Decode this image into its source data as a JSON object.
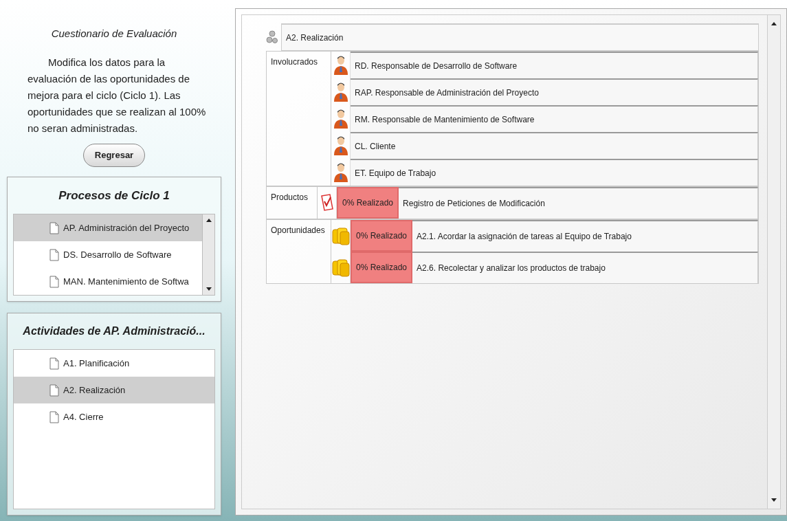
{
  "sidebar": {
    "title": "Cuestionario de Evaluación",
    "description": "Modifica los datos para la evaluación de las oportunidades de mejora para el ciclo (Ciclo 1). Las oportunidades que se realizan al 100% no seran administradas.",
    "back_button": "Regresar"
  },
  "processes": {
    "title": "Procesos de Ciclo 1",
    "items": [
      {
        "label": "AP. Administración del Proyecto",
        "selected": true
      },
      {
        "label": "DS. Desarrollo de Software",
        "selected": false
      },
      {
        "label": "MAN. Mantenimiento de Softwa",
        "selected": false
      }
    ]
  },
  "activities": {
    "title": "Actividades de AP. Administració...",
    "items": [
      {
        "label": "A1. Planificación",
        "selected": false
      },
      {
        "label": "A2. Realización",
        "selected": true
      },
      {
        "label": "A4. Cierre",
        "selected": false
      }
    ]
  },
  "detail": {
    "activity": "A2. Realización",
    "sections": [
      {
        "kind": "people",
        "label": "Involucrados",
        "rows": [
          {
            "name": "RD. Responsable de Desarrollo de Software"
          },
          {
            "name": "RAP. Responsable de Administración del Proyecto"
          },
          {
            "name": "RM. Responsable de Mantenimiento de Software"
          },
          {
            "name": "CL. Cliente"
          },
          {
            "name": "ET. Equipo de Trabajo"
          }
        ]
      },
      {
        "kind": "products",
        "label": "Productos",
        "rows": [
          {
            "status": "0% Realizado",
            "name": "Registro de Peticiones de Modificación"
          }
        ]
      },
      {
        "kind": "opportunities",
        "label": "Oportunidades",
        "rows": [
          {
            "status": "0% Realizado",
            "name": "A2.1. Acordar la asignación de tareas al Equipo de Trabajo"
          },
          {
            "status": "0% Realizado",
            "name": "A2.6. Recolectar y analizar los productos de trabajo"
          }
        ]
      }
    ]
  }
}
